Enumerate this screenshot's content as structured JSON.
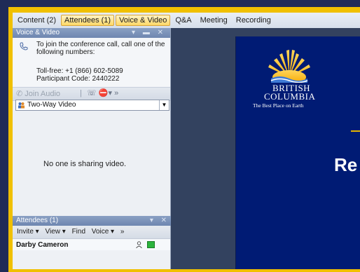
{
  "menubar": {
    "items": [
      {
        "label": "Content (2)"
      },
      {
        "label": "Attendees (1)"
      },
      {
        "label": "Voice & Video"
      },
      {
        "label": "Q&A"
      },
      {
        "label": "Meeting"
      },
      {
        "label": "Recording"
      }
    ]
  },
  "voice_panel": {
    "title": "Voice & Video",
    "call_instructions": "To join the conference call, call one of the following numbers:",
    "toll_free": "Toll-free: +1 (866) 602-5089",
    "participant_code": "Participant Code: 2440222",
    "join_audio_label": "Join Audio",
    "more_label": "»",
    "video_mode": "Two-Way Video",
    "no_video_text": "No one is sharing video."
  },
  "attendees_panel": {
    "title": "Attendees (1)",
    "toolbar": {
      "invite": "Invite ▾",
      "view": "View ▾",
      "find": "Find",
      "voice": "Voice ▾",
      "more": "»"
    },
    "rows": [
      {
        "name": "Darby Cameron",
        "status_color": "#2bb33d"
      }
    ]
  },
  "slide": {
    "logo_line1": "BRITISH",
    "logo_line2": "COLUMBIA",
    "tagline": "The Best Place on Earth",
    "heading_fragment": "Re"
  },
  "colors": {
    "accent_yellow": "#f0c000",
    "slide_blue": "#001b74",
    "panel_title": "#6e86b0"
  }
}
